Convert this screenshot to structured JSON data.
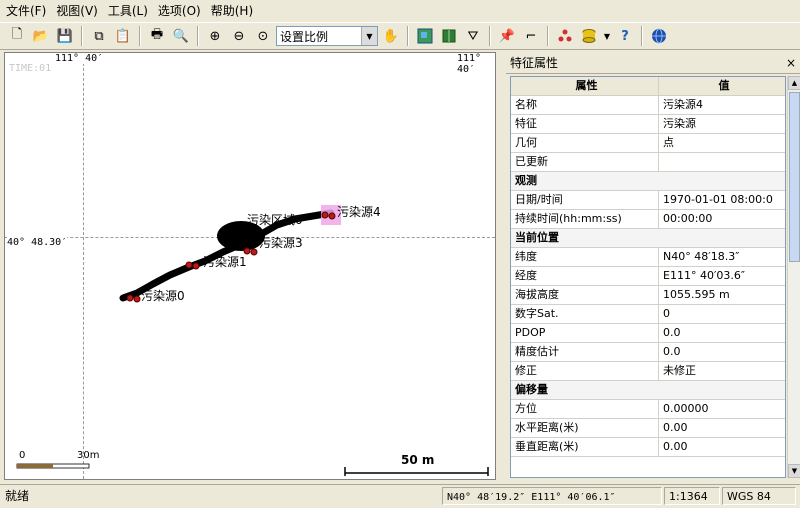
{
  "menu": [
    "文件(F)",
    "视图(V)",
    "工具(L)",
    "选项(O)",
    "帮助(H)"
  ],
  "toolbar": {
    "scale_select": "设置比例"
  },
  "map": {
    "time_label": "TIME:01",
    "top_left_coord": "111° 40′",
    "top_right_coord": "111° 40′",
    "left_coord": "40° 48.30′",
    "scalebar_left": {
      "zero": "0",
      "end": "30m"
    },
    "scalebar_right": "50 m",
    "features": {
      "area": "污染区域0",
      "source0": "污染源0",
      "source1": "污染源1",
      "source3": "污染源3",
      "source4": "污染源4"
    }
  },
  "panel": {
    "title": "特征属性",
    "close_label": "×",
    "col_property": "属性",
    "col_value": "值",
    "rows": [
      {
        "type": "row",
        "key": "名称",
        "value": "污染源4"
      },
      {
        "type": "row",
        "key": "特征",
        "value": "污染源"
      },
      {
        "type": "row",
        "key": "几何",
        "value": "点"
      },
      {
        "type": "row",
        "key": "已更新",
        "value": ""
      },
      {
        "type": "cat",
        "key": "观测"
      },
      {
        "type": "row",
        "key": "日期/时间",
        "value": "1970-01-01 08:00:0"
      },
      {
        "type": "row",
        "key": "持续时间(hh:mm:ss)",
        "value": "00:00:00"
      },
      {
        "type": "cat",
        "key": "当前位置"
      },
      {
        "type": "row",
        "key": "纬度",
        "value": "N40° 48′18.3″"
      },
      {
        "type": "row",
        "key": "经度",
        "value": "E111° 40′03.6″"
      },
      {
        "type": "row",
        "key": "海拔高度",
        "value": "1055.595 m"
      },
      {
        "type": "row",
        "key": "数字Sat.",
        "value": "0"
      },
      {
        "type": "row",
        "key": "PDOP",
        "value": "0.0"
      },
      {
        "type": "row",
        "key": "精度估计",
        "value": "0.0"
      },
      {
        "type": "row",
        "key": "修正",
        "value": "未修正"
      },
      {
        "type": "cat",
        "key": "偏移量"
      },
      {
        "type": "row",
        "key": "方位",
        "value": "0.00000"
      },
      {
        "type": "row",
        "key": "水平距离(米)",
        "value": "0.00"
      },
      {
        "type": "row",
        "key": "垂直距离(米)",
        "value": "0.00"
      }
    ]
  },
  "status": {
    "text": "就绪",
    "coords": "N40° 48′19.2″ E111° 40′06.1″",
    "scale": "1:1364",
    "datum": "WGS 84"
  }
}
